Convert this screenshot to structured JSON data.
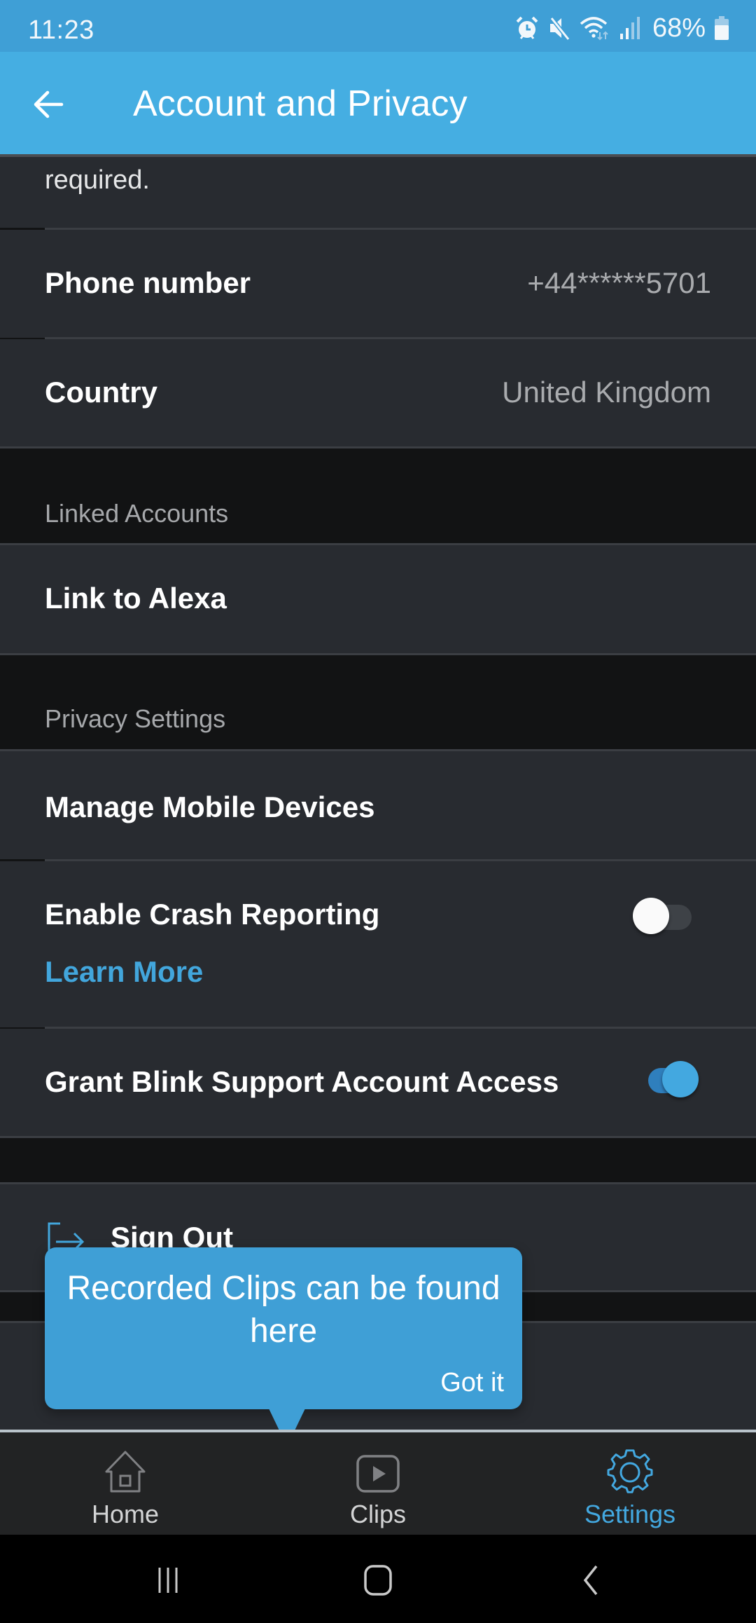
{
  "status_bar": {
    "time": "11:23",
    "icons": [
      "alarm-icon",
      "mute-icon",
      "wifi-icon",
      "signal-icon"
    ],
    "battery_percent": "68%"
  },
  "app_bar": {
    "back_icon": "arrow-left-icon",
    "title": "Account and Privacy"
  },
  "account_section": {
    "truncated_text": "required.",
    "rows": [
      {
        "label": "Phone number",
        "value": "+44******5701"
      },
      {
        "label": "Country",
        "value": "United Kingdom"
      }
    ]
  },
  "linked_accounts": {
    "header": "Linked Accounts",
    "rows": [
      {
        "label": "Link to Alexa"
      }
    ]
  },
  "privacy_settings": {
    "header": "Privacy Settings",
    "manage_devices": {
      "label": "Manage Mobile Devices"
    },
    "crash_reporting": {
      "label": "Enable Crash Reporting",
      "link": "Learn More",
      "enabled": false
    },
    "support_access": {
      "label": "Grant Blink Support Account Access",
      "enabled": true
    }
  },
  "sign_out": {
    "label": "Sign Out",
    "icon": "sign-out-icon"
  },
  "tooltip": {
    "message": "Recorded Clips can be found here",
    "button": "Got it"
  },
  "bottom_nav": {
    "items": [
      {
        "label": "Home",
        "icon": "home-icon",
        "active": false
      },
      {
        "label": "Clips",
        "icon": "play-icon",
        "active": false
      },
      {
        "label": "Settings",
        "icon": "gear-icon",
        "active": true
      }
    ]
  },
  "system_nav": {
    "buttons": [
      "recents-icon",
      "home-circle-icon",
      "back-chevron-icon"
    ]
  },
  "colors": {
    "accent": "#43a8e0",
    "app_bar": "#45aee2",
    "status_bar": "#3f9fd6",
    "cell_bg": "#282b30",
    "section_bg": "#121314"
  }
}
